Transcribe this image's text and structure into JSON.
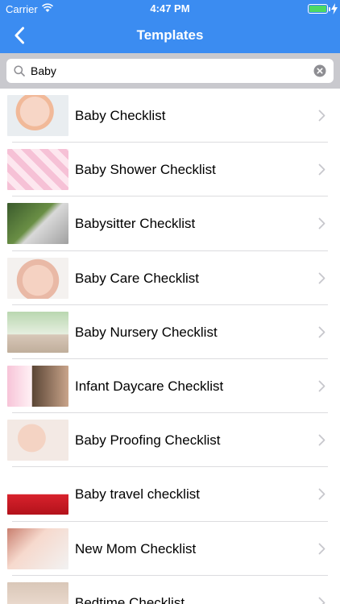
{
  "status_bar": {
    "carrier": "Carrier",
    "time": "4:47 PM",
    "battery_level": 1.0,
    "battery_color": "#4cd964"
  },
  "nav": {
    "title": "Templates",
    "back_icon": "chevron-left-icon"
  },
  "search": {
    "value": "Baby",
    "placeholder": "Search"
  },
  "colors": {
    "header_bg": "#3b8cf1",
    "search_bar_bg": "#c9c9ce",
    "chevron": "#c7c7cc"
  },
  "templates": [
    {
      "label": "Baby Checklist"
    },
    {
      "label": "Baby Shower Checklist"
    },
    {
      "label": "Babysitter Checklist"
    },
    {
      "label": "Baby Care Checklist"
    },
    {
      "label": "Baby Nursery Checklist"
    },
    {
      "label": "Infant Daycare Checklist"
    },
    {
      "label": "Baby Proofing Checklist"
    },
    {
      "label": "Baby travel checklist"
    },
    {
      "label": "New Mom Checklist"
    },
    {
      "label": "Bedtime Checklist"
    }
  ]
}
